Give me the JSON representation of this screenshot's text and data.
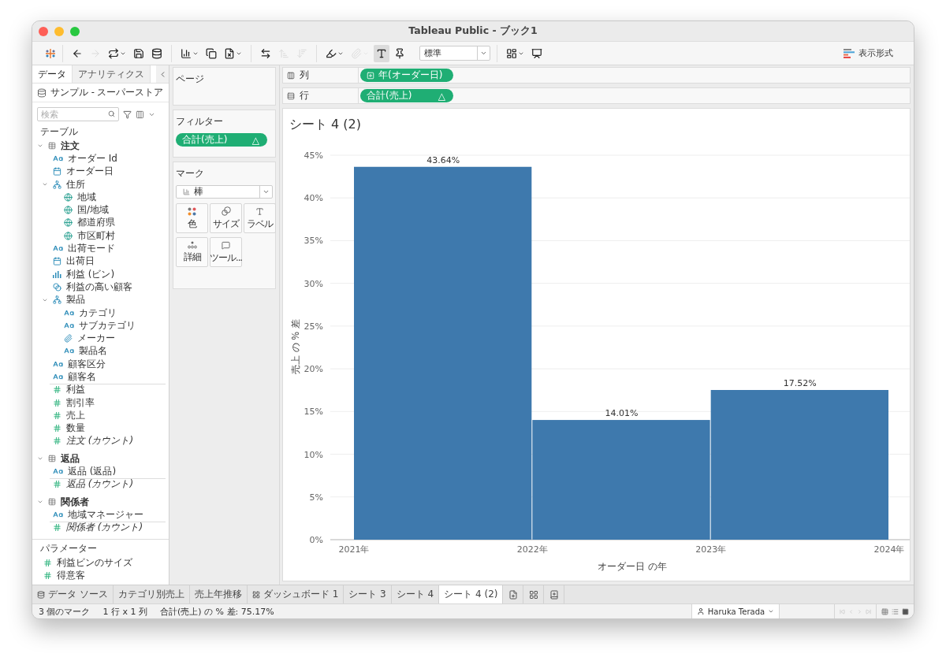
{
  "window": {
    "title": "Tableau Public - ブック1"
  },
  "toolbar": {
    "groups": [
      [
        {
          "kind": "back",
          "disabled": false,
          "pressed": false,
          "menu": false
        },
        {
          "kind": "forward",
          "disabled": true,
          "pressed": false,
          "menu": false
        },
        {
          "kind": "redo",
          "disabled": false,
          "pressed": false,
          "menu": true
        },
        {
          "kind": "save",
          "disabled": false,
          "pressed": false,
          "menu": false
        },
        {
          "kind": "new-datasource",
          "disabled": false,
          "pressed": false,
          "menu": false
        }
      ],
      [
        {
          "kind": "new-sheet",
          "disabled": false,
          "pressed": false,
          "menu": true
        },
        {
          "kind": "duplicate",
          "disabled": false,
          "pressed": false,
          "menu": false
        },
        {
          "kind": "clear",
          "disabled": false,
          "pressed": false,
          "menu": true
        }
      ],
      [
        {
          "kind": "swap",
          "disabled": false,
          "pressed": false,
          "menu": false
        },
        {
          "kind": "sort-asc",
          "disabled": true,
          "pressed": false,
          "menu": false
        },
        {
          "kind": "sort-desc",
          "disabled": true,
          "pressed": false,
          "menu": false
        }
      ],
      [
        {
          "kind": "highlight",
          "disabled": false,
          "pressed": false,
          "menu": true
        },
        {
          "kind": "group",
          "disabled": true,
          "pressed": false,
          "menu": true
        },
        {
          "kind": "labels",
          "disabled": false,
          "pressed": true,
          "menu": false
        },
        {
          "kind": "pin",
          "disabled": false,
          "pressed": false,
          "menu": false
        },
        {
          "kind": "fit-select",
          "value": "標準"
        }
      ],
      [
        {
          "kind": "show-me",
          "disabled": false,
          "pressed": false,
          "menu": true
        },
        {
          "kind": "present",
          "disabled": false,
          "pressed": false,
          "menu": false
        }
      ]
    ],
    "format_button": "表示形式"
  },
  "data_pane": {
    "tabs": [
      {
        "label": "データ",
        "selected": true
      },
      {
        "label": "アナリティクス",
        "selected": false
      }
    ],
    "datasource": "サンプル - スーパーストア",
    "search": {
      "placeholder": "検索"
    },
    "tables_heading": "テーブル",
    "tables": [
      {
        "name": "注文",
        "expanded": true,
        "fields": [
          {
            "label": "オーダー Id",
            "kind": "string"
          },
          {
            "label": "オーダー日",
            "kind": "date"
          },
          {
            "label": "住所",
            "kind": "hierarchy",
            "expanded": true,
            "children": [
              {
                "label": "地域",
                "kind": "geo"
              },
              {
                "label": "国/地域",
                "kind": "geo"
              },
              {
                "label": "都道府県",
                "kind": "geo"
              },
              {
                "label": "市区町村",
                "kind": "geo"
              }
            ]
          },
          {
            "label": "出荷モード",
            "kind": "string"
          },
          {
            "label": "出荷日",
            "kind": "date"
          },
          {
            "label": "利益 (ビン)",
            "kind": "bin"
          },
          {
            "label": "利益の高い顧客",
            "kind": "set"
          },
          {
            "label": "製品",
            "kind": "hierarchy",
            "expanded": true,
            "children": [
              {
                "label": "カテゴリ",
                "kind": "string"
              },
              {
                "label": "サブカテゴリ",
                "kind": "string"
              },
              {
                "label": "メーカー",
                "kind": "group"
              },
              {
                "label": "製品名",
                "kind": "string"
              }
            ]
          },
          {
            "label": "顧客区分",
            "kind": "string"
          },
          {
            "label": "顧客名",
            "kind": "string"
          },
          {
            "label": "利益",
            "kind": "measure"
          },
          {
            "label": "割引率",
            "kind": "measure"
          },
          {
            "label": "売上",
            "kind": "measure"
          },
          {
            "label": "数量",
            "kind": "measure"
          },
          {
            "label": "注文 (カウント)",
            "kind": "count"
          }
        ]
      },
      {
        "name": "返品",
        "expanded": true,
        "fields": [
          {
            "label": "返品 (返品)",
            "kind": "string"
          },
          {
            "label": "返品 (カウント)",
            "kind": "count"
          }
        ]
      },
      {
        "name": "関係者",
        "expanded": true,
        "fields": [
          {
            "label": "地域マネージャー",
            "kind": "string"
          },
          {
            "label": "関係者 (カウント)",
            "kind": "count"
          }
        ]
      }
    ],
    "parameters_heading": "パラメーター",
    "parameters": [
      {
        "label": "利益ビンのサイズ"
      },
      {
        "label": "得意客"
      }
    ]
  },
  "pages": {
    "title": "ページ"
  },
  "filters": {
    "title": "フィルター",
    "pills": [
      {
        "label": "合計(売上)",
        "marker": "△"
      }
    ]
  },
  "marks": {
    "title": "マーク",
    "type": "棒",
    "cards": [
      {
        "kind": "color",
        "label": "色"
      },
      {
        "kind": "size",
        "label": "サイズ"
      },
      {
        "kind": "label",
        "label": "ラベル"
      },
      {
        "kind": "detail",
        "label": "詳細"
      },
      {
        "kind": "tooltip",
        "label": "ツール..."
      }
    ]
  },
  "columns": {
    "label": "列",
    "pills": [
      {
        "label": "年(オーダー日)",
        "expandable": true
      }
    ]
  },
  "rows": {
    "label": "行",
    "pills": [
      {
        "label": "合計(売上)",
        "marker": "△"
      }
    ]
  },
  "sheet": {
    "title": "シート 4 (2)",
    "chart_data": {
      "type": "bar",
      "xlabel": "オーダー日 の年",
      "ylabel": "売上 の % 差",
      "x": [
        2021.5,
        2022.5,
        2023.5
      ],
      "series": [
        {
          "color": "#3e79ad",
          "values": [
            43.64,
            14.01,
            17.52
          ]
        }
      ],
      "grid": true,
      "xlim": [
        2021,
        2024
      ],
      "ylim": [
        0,
        45
      ],
      "xticks": [
        {
          "value": 2021,
          "label": "2021年"
        },
        {
          "value": 2022,
          "label": "2022年"
        },
        {
          "value": 2023,
          "label": "2023年"
        },
        {
          "value": 2024,
          "label": "2024年"
        }
      ],
      "yticks": [
        {
          "value": 0,
          "label": "0%"
        },
        {
          "value": 5,
          "label": "5%"
        },
        {
          "value": 10,
          "label": "10%"
        },
        {
          "value": 15,
          "label": "15%"
        },
        {
          "value": 20,
          "label": "20%"
        },
        {
          "value": 25,
          "label": "25%"
        },
        {
          "value": 30,
          "label": "30%"
        },
        {
          "value": 35,
          "label": "35%"
        },
        {
          "value": 40,
          "label": "40%"
        },
        {
          "value": 45,
          "label": "45%"
        }
      ],
      "value_labels": [
        "43.64%",
        "14.01%",
        "17.52%"
      ]
    }
  },
  "sheet_tabs": [
    {
      "label": "データ ソース",
      "kind": "datasource",
      "selected": false
    },
    {
      "label": "カテゴリ別売上",
      "kind": "sheet",
      "selected": false
    },
    {
      "label": "売上年推移",
      "kind": "sheet",
      "selected": false
    },
    {
      "label": "ダッシュボード 1",
      "kind": "dashboard",
      "selected": false
    },
    {
      "label": "シート 3",
      "kind": "sheet",
      "selected": false
    },
    {
      "label": "シート 4",
      "kind": "sheet",
      "selected": false
    },
    {
      "label": "シート 4 (2)",
      "kind": "sheet",
      "selected": true
    }
  ],
  "new_tab_buttons": [
    {
      "kind": "new-sheet"
    },
    {
      "kind": "new-dashboard"
    },
    {
      "kind": "new-story"
    }
  ],
  "status_bar": {
    "texts": [
      "3 個のマーク",
      "1 行 x 1 列",
      "合計(売上) の % 差: 75.17%"
    ],
    "user": "Haruka Terada"
  }
}
